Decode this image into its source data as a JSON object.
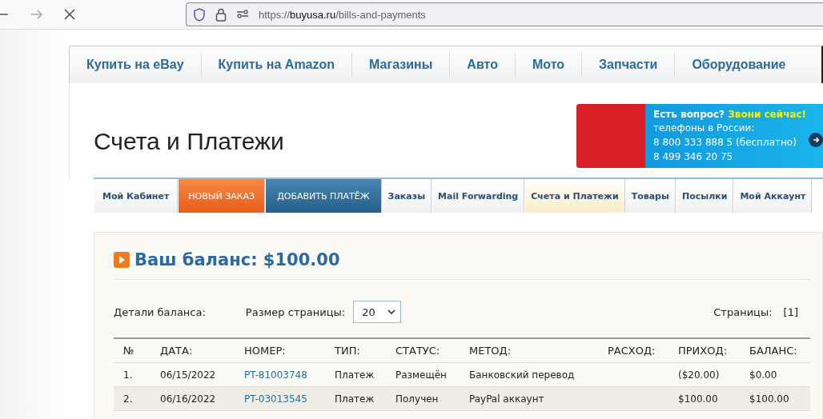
{
  "browser": {
    "url_host": "buyusa.ru",
    "url_path": "/bills-and-payments",
    "url_scheme": "https://"
  },
  "top_nav": [
    {
      "label": "Купить на eBay"
    },
    {
      "label": "Купить на Amazon"
    },
    {
      "label": "Магазины"
    },
    {
      "label": "Авто"
    },
    {
      "label": "Мото"
    },
    {
      "label": "Запчасти"
    },
    {
      "label": "Оборудование"
    }
  ],
  "page_title": "Счета и Платежи",
  "banner": {
    "question": "Есть вопрос?",
    "cta": "Звони сейчас!",
    "subtitle": "телефоны в России:",
    "phones": [
      "8 800 333 888 5 (бесплатно)",
      "8 499 346 20 75"
    ]
  },
  "tabs": [
    {
      "label": "Мой Кабинет",
      "kind": "plain",
      "selected": false
    },
    {
      "label": "НОВЫЙ ЗАКАЗ",
      "kind": "orange",
      "selected": false
    },
    {
      "label": "ДОБАВИТЬ ПЛАТЁЖ",
      "kind": "blue",
      "selected": false
    },
    {
      "label": "Заказы",
      "kind": "plain",
      "selected": false
    },
    {
      "label": "Mail Forwarding",
      "kind": "plain",
      "selected": false
    },
    {
      "label": "Счета и Платежи",
      "kind": "plain",
      "selected": true
    },
    {
      "label": "Товары",
      "kind": "plain",
      "selected": false
    },
    {
      "label": "Посылки",
      "kind": "plain",
      "selected": false
    },
    {
      "label": "Мой Аккаунт",
      "kind": "plain",
      "selected": false
    }
  ],
  "balance": {
    "title": "Ваш баланс: $100.00",
    "details_label": "Детали баланса:",
    "page_size_label": "Размер страницы:",
    "page_size": "20",
    "pages_label": "Страницы:",
    "pages": "[1]"
  },
  "table": {
    "columns": [
      "№",
      "ДАТА:",
      "НОМЕР:",
      "ТИП:",
      "СТАТУС:",
      "МЕТОД:",
      "РАСХОД:",
      "ПРИХОД:",
      "БАЛАНС:"
    ],
    "rows": [
      [
        "1.",
        "06/15/2022",
        "PT-81003748",
        "Платеж",
        "Размещён",
        "Банковский перевод",
        "",
        "($20.00)",
        "$0.00"
      ],
      [
        "2.",
        "06/16/2022",
        "PT-03013545",
        "Платеж",
        "Получен",
        "PayPal аккаунт",
        "",
        "$100.00",
        "$100.00"
      ]
    ]
  }
}
